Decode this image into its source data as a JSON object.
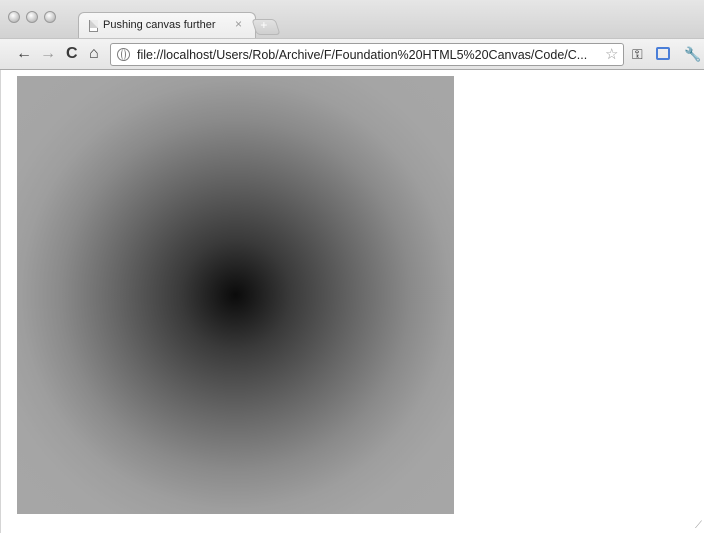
{
  "tab": {
    "title": "Pushing canvas further",
    "close_label": "×",
    "new_tab_label": "+"
  },
  "toolbar": {
    "back_label": "←",
    "forward_label": "→",
    "reload_label": "C",
    "home_label": "⌂",
    "star_label": "☆",
    "key_label": "⚿",
    "wrench_label": "🔧"
  },
  "address": {
    "url": "file://localhost/Users/Rob/Archive/F/Foundation%20HTML5%20Canvas/Code/C..."
  },
  "icons": {
    "page": "page-icon",
    "globe": "globe-icon",
    "back": "back-arrow-icon",
    "forward": "forward-arrow-icon",
    "reload": "reload-icon",
    "home": "home-icon",
    "bookmark": "star-icon",
    "key": "key-icon",
    "page_action": "page-action-icon",
    "wrench": "wrench-icon"
  },
  "colors": {
    "gradient_center": "#0b0b0b",
    "gradient_edge": "#a6a6a6",
    "accent": "#4a7ed8"
  }
}
